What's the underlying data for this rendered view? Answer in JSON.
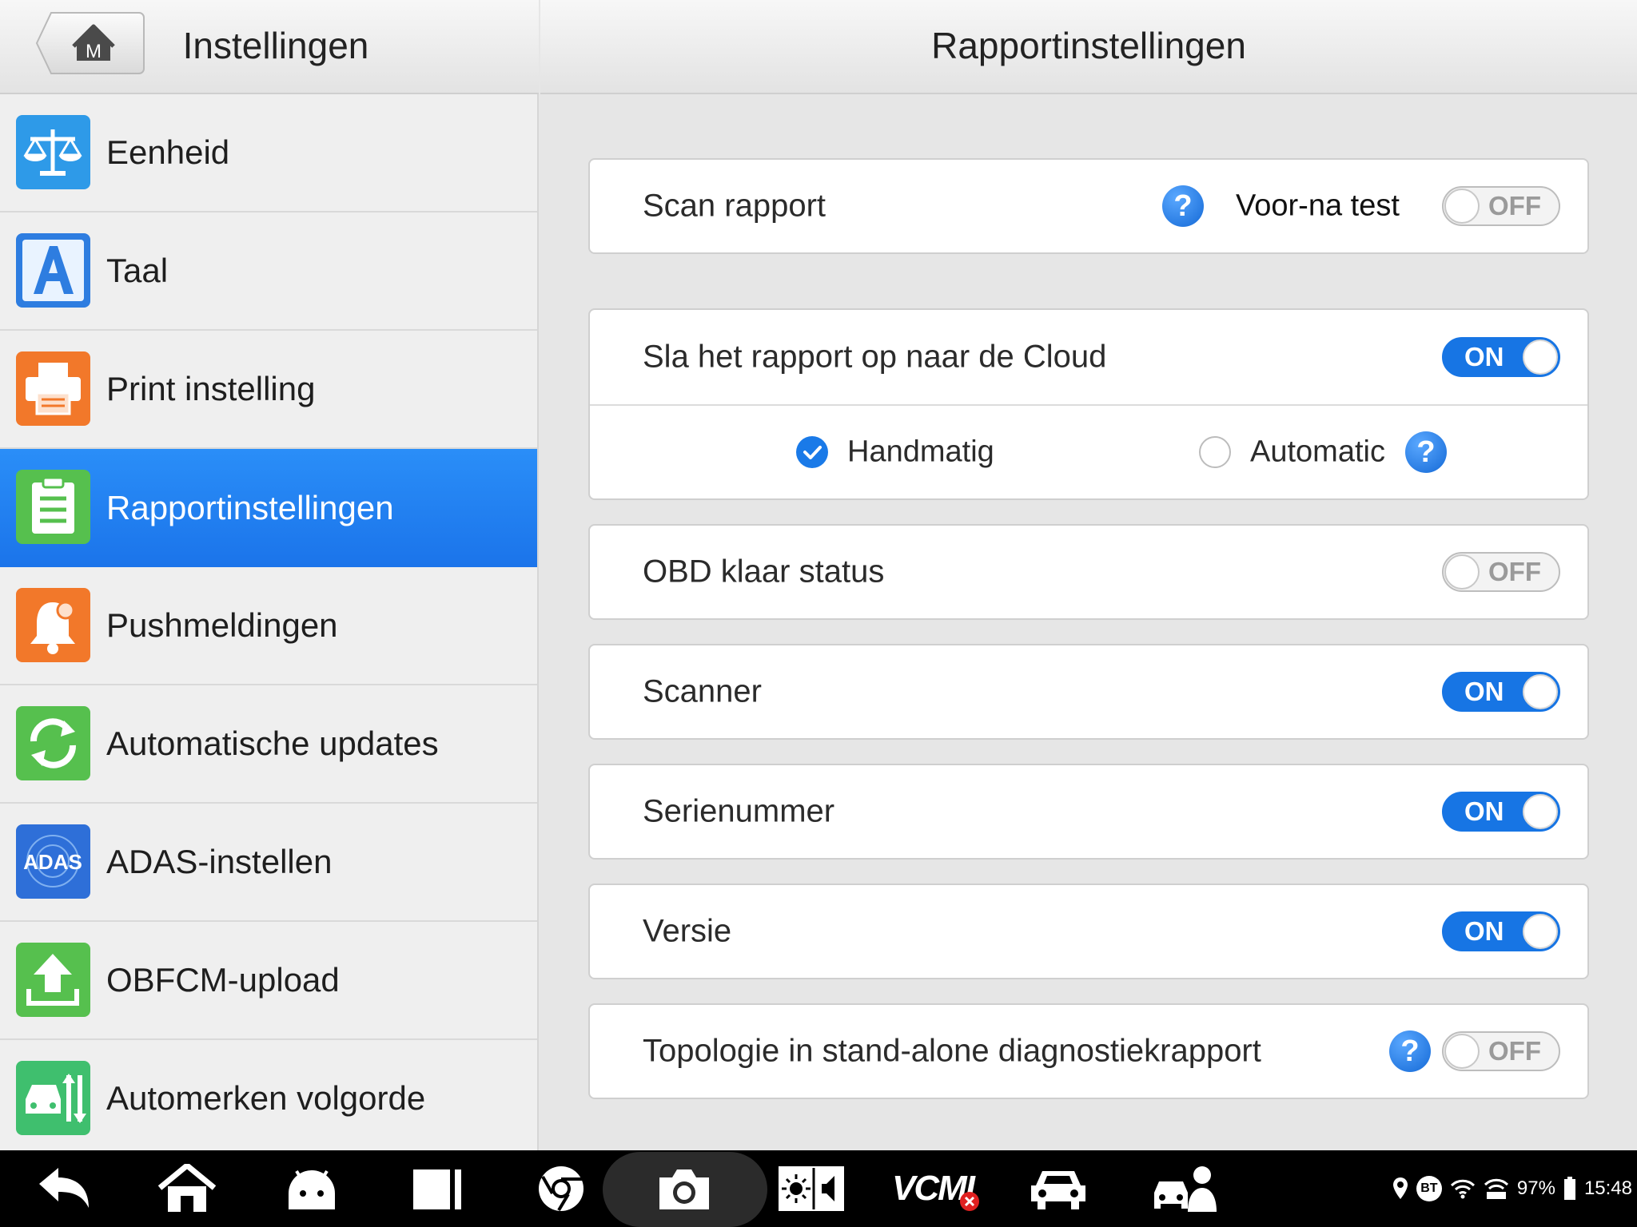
{
  "sidebar": {
    "title": "Instellingen",
    "home_button_letter": "M",
    "items": [
      {
        "label": "Eenheid",
        "icon": "scale-icon",
        "color": "#2e9ae8",
        "active": false
      },
      {
        "label": "Taal",
        "icon": "language-a-icon",
        "color": "#2e7de0",
        "active": false
      },
      {
        "label": "Print instelling",
        "icon": "printer-icon",
        "color": "#f2782a",
        "active": false
      },
      {
        "label": "Rapportinstellingen",
        "icon": "clipboard-icon",
        "color": "#56c04e",
        "active": true
      },
      {
        "label": "Pushmeldingen",
        "icon": "bell-icon",
        "color": "#f2782a",
        "active": false
      },
      {
        "label": "Automatische updates",
        "icon": "refresh-icon",
        "color": "#56c04e",
        "active": false
      },
      {
        "label": "ADAS-instellen",
        "icon": "adas-icon",
        "color": "#2e6fd8",
        "active": false
      },
      {
        "label": "OBFCM-upload",
        "icon": "upload-icon",
        "color": "#56c04e",
        "active": false
      },
      {
        "label": "Automerken volgorde",
        "icon": "car-sort-icon",
        "color": "#3fbf6e",
        "active": false
      }
    ]
  },
  "main": {
    "title": "Rapportinstellingen",
    "scan_report": {
      "label": "Scan rapport",
      "prepost_label": "Voor-na test",
      "prepost_state": "OFF"
    },
    "cloud": {
      "label": "Sla het rapport op naar de Cloud",
      "state": "ON",
      "options": [
        {
          "label": "Handmatig",
          "checked": true
        },
        {
          "label": "Automatic",
          "checked": false
        }
      ]
    },
    "rows": [
      {
        "label": "OBD klaar status",
        "state": "OFF",
        "help": false
      },
      {
        "label": "Scanner",
        "state": "ON",
        "help": false
      },
      {
        "label": "Serienummer",
        "state": "ON",
        "help": false
      },
      {
        "label": "Versie",
        "state": "ON",
        "help": false
      },
      {
        "label": "Topologie in stand-alone diagnostiekrapport",
        "state": "OFF",
        "help": true
      }
    ],
    "help_glyph": "?"
  },
  "navbar": {
    "vcmi_label": "VCMI",
    "bt_label": "BT",
    "battery": "97%",
    "time": "15:48",
    "icons": [
      "back-icon",
      "home-icon",
      "android-icon",
      "recent-apps-icon",
      "browser-icon",
      "camera-icon",
      "brightness-volume-icon",
      "vcmi-icon",
      "car-icon",
      "car-service-icon"
    ]
  },
  "colors": {
    "accent": "#1b74ea",
    "toggle_on": "#1775e4",
    "background": "#e6e6e6"
  }
}
